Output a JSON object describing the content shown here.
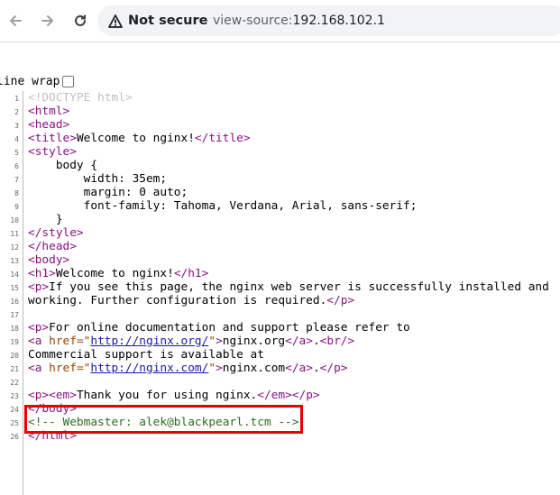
{
  "browser": {
    "security_label": "Not secure",
    "url_scheme": "view-source:",
    "url_host": "192.168.102.1"
  },
  "line_wrap_label": "line wrap",
  "source": {
    "lines": [
      {
        "n": "1",
        "parts": [
          {
            "c": "doctype",
            "t": "<!DOCTYPE html>"
          }
        ]
      },
      {
        "n": "2",
        "parts": [
          {
            "c": "tag",
            "t": "<html>"
          }
        ]
      },
      {
        "n": "3",
        "parts": [
          {
            "c": "tag",
            "t": "<head>"
          }
        ]
      },
      {
        "n": "4",
        "parts": [
          {
            "c": "tag",
            "t": "<title>"
          },
          {
            "c": "plain",
            "t": "Welcome to nginx!"
          },
          {
            "c": "tag",
            "t": "</title>"
          }
        ]
      },
      {
        "n": "5",
        "parts": [
          {
            "c": "tag",
            "t": "<style>"
          }
        ]
      },
      {
        "n": "6",
        "parts": [
          {
            "c": "plain",
            "t": "    body {"
          }
        ]
      },
      {
        "n": "7",
        "parts": [
          {
            "c": "plain",
            "t": "        width: 35em;"
          }
        ]
      },
      {
        "n": "8",
        "parts": [
          {
            "c": "plain",
            "t": "        margin: 0 auto;"
          }
        ]
      },
      {
        "n": "9",
        "parts": [
          {
            "c": "plain",
            "t": "        font-family: Tahoma, Verdana, Arial, sans-serif;"
          }
        ]
      },
      {
        "n": "10",
        "parts": [
          {
            "c": "plain",
            "t": "    }"
          }
        ]
      },
      {
        "n": "11",
        "parts": [
          {
            "c": "tag",
            "t": "</style>"
          }
        ]
      },
      {
        "n": "12",
        "parts": [
          {
            "c": "tag",
            "t": "</head>"
          }
        ]
      },
      {
        "n": "13",
        "parts": [
          {
            "c": "tag",
            "t": "<body>"
          }
        ]
      },
      {
        "n": "14",
        "parts": [
          {
            "c": "tag",
            "t": "<h1>"
          },
          {
            "c": "plain",
            "t": "Welcome to nginx!"
          },
          {
            "c": "tag",
            "t": "</h1>"
          }
        ]
      },
      {
        "n": "15",
        "parts": [
          {
            "c": "tag",
            "t": "<p>"
          },
          {
            "c": "plain",
            "t": "If you see this page, the nginx web server is successfully installed and"
          }
        ]
      },
      {
        "n": "16",
        "parts": [
          {
            "c": "plain",
            "t": "working. Further configuration is required."
          },
          {
            "c": "tag",
            "t": "</p>"
          }
        ]
      },
      {
        "n": "17",
        "parts": []
      },
      {
        "n": "18",
        "parts": [
          {
            "c": "tag",
            "t": "<p>"
          },
          {
            "c": "plain",
            "t": "For online documentation and support please refer to"
          }
        ]
      },
      {
        "n": "19",
        "parts": [
          {
            "c": "tag",
            "t": "<a "
          },
          {
            "c": "attr",
            "t": "href=\""
          },
          {
            "c": "val",
            "t": "http://nginx.org/"
          },
          {
            "c": "attr",
            "t": "\""
          },
          {
            "c": "tag",
            "t": ">"
          },
          {
            "c": "plain",
            "t": "nginx.org"
          },
          {
            "c": "tag",
            "t": "</a>"
          },
          {
            "c": "plain",
            "t": "."
          },
          {
            "c": "tag",
            "t": "<br/>"
          }
        ]
      },
      {
        "n": "20",
        "parts": [
          {
            "c": "plain",
            "t": "Commercial support is available at"
          }
        ]
      },
      {
        "n": "21",
        "parts": [
          {
            "c": "tag",
            "t": "<a "
          },
          {
            "c": "attr",
            "t": "href=\""
          },
          {
            "c": "val",
            "t": "http://nginx.com/"
          },
          {
            "c": "attr",
            "t": "\""
          },
          {
            "c": "tag",
            "t": ">"
          },
          {
            "c": "plain",
            "t": "nginx.com"
          },
          {
            "c": "tag",
            "t": "</a>"
          },
          {
            "c": "plain",
            "t": "."
          },
          {
            "c": "tag",
            "t": "</p>"
          }
        ]
      },
      {
        "n": "22",
        "parts": []
      },
      {
        "n": "23",
        "parts": [
          {
            "c": "tag",
            "t": "<p><em>"
          },
          {
            "c": "plain",
            "t": "Thank you for using nginx."
          },
          {
            "c": "tag",
            "t": "</em></p>"
          }
        ]
      },
      {
        "n": "24",
        "parts": [
          {
            "c": "tag",
            "t": "</body>"
          }
        ]
      },
      {
        "n": "25",
        "parts": [
          {
            "c": "comment",
            "t": "<!-- Webmaster: alek@blackpearl.tcm -->"
          }
        ]
      },
      {
        "n": "26",
        "parts": [
          {
            "c": "tag",
            "t": "</html>"
          }
        ]
      }
    ]
  },
  "colors": {
    "tag": "#881280",
    "comment": "#236e25",
    "attribute": "#994500",
    "link": "#1a1aa6",
    "highlight_box": "#e60000"
  }
}
